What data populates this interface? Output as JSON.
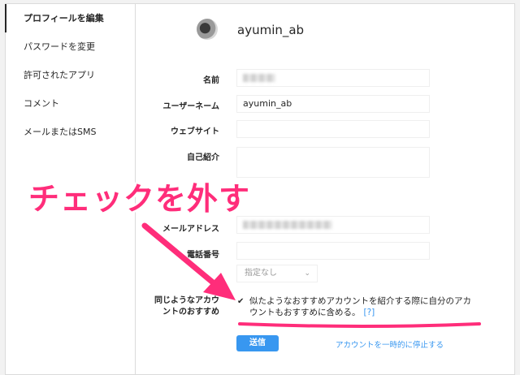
{
  "sidebar": {
    "items": [
      {
        "label": "プロフィールを編集",
        "active": true
      },
      {
        "label": "パスワードを変更"
      },
      {
        "label": "許可されたアプリ"
      },
      {
        "label": "コメント"
      },
      {
        "label": "メールまたはSMS"
      }
    ]
  },
  "profile": {
    "username": "ayumin_ab"
  },
  "form": {
    "name_label": "名前",
    "username_label": "ユーザーネーム",
    "username_value": "ayumin_ab",
    "website_label": "ウェブサイト",
    "bio_label": "自己紹介",
    "email_label": "メールアドレス",
    "phone_label": "電話番号",
    "gender_value": "指定なし",
    "suggest_label_line1": "同じようなアカウ",
    "suggest_label_line2": "ントのおすすめ",
    "suggest_text": "似たようなおすすめアカウントを紹介する際に自分のアカウントもおすすめに含める。",
    "suggest_help": "[?]",
    "submit_label": "送信",
    "disable_link": "アカウントを一時的に停止する"
  },
  "annotation": {
    "text": "チェックを外す",
    "color": "#ff2d7a"
  },
  "colors": {
    "accent": "#3897f0",
    "annotation": "#ff2d7a"
  },
  "icons": {
    "checkmark": "check-icon",
    "dropdown": "chevron-down-icon"
  }
}
